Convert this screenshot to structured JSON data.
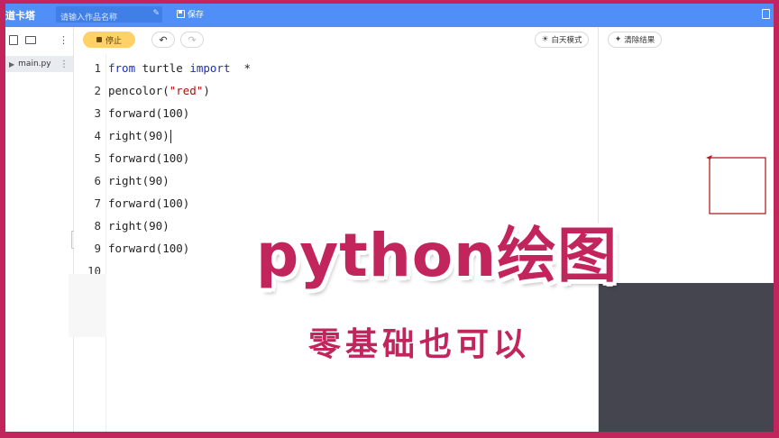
{
  "app": {
    "brand": "道卡塔",
    "search_placeholder": "请输入作品名称",
    "save_label": "保存"
  },
  "sidebar": {
    "file_name": "main.py"
  },
  "toolbar": {
    "stop_label": "停止",
    "undo_icon": "undo-icon",
    "redo_icon": "redo-icon",
    "day_mode_label": "白天模式"
  },
  "editor": {
    "active_line": 4,
    "lines": [
      {
        "n": "1",
        "segments": [
          {
            "t": "from",
            "c": "kw"
          },
          {
            "t": " turtle ",
            "c": ""
          },
          {
            "t": "import",
            "c": "kw"
          },
          {
            "t": "  *",
            "c": ""
          }
        ]
      },
      {
        "n": "2",
        "segments": [
          {
            "t": "pencolor(",
            "c": ""
          },
          {
            "t": "\"red\"",
            "c": "str"
          },
          {
            "t": ")",
            "c": ""
          }
        ]
      },
      {
        "n": "3",
        "segments": [
          {
            "t": "forward(100)",
            "c": ""
          }
        ]
      },
      {
        "n": "4",
        "segments": [
          {
            "t": "right(90)",
            "c": ""
          }
        ]
      },
      {
        "n": "5",
        "segments": [
          {
            "t": "forward(100)",
            "c": ""
          }
        ]
      },
      {
        "n": "6",
        "segments": [
          {
            "t": "right(90)",
            "c": ""
          }
        ]
      },
      {
        "n": "7",
        "segments": [
          {
            "t": "forward(100)",
            "c": ""
          }
        ]
      },
      {
        "n": "8",
        "segments": [
          {
            "t": "right(90)",
            "c": ""
          }
        ]
      },
      {
        "n": "9",
        "segments": [
          {
            "t": "forward(100)",
            "c": ""
          }
        ]
      },
      {
        "n": "10",
        "segments": []
      }
    ]
  },
  "output": {
    "clear_label": "清除结果",
    "square_color": "#b22222",
    "panel_color": "#45454f"
  },
  "overlay": {
    "title": "python绘图",
    "subtitle": "零基础也可以"
  },
  "colors": {
    "accent": "#c2255c",
    "topbar": "#4f8ff7",
    "stop_button": "#ffd166"
  }
}
